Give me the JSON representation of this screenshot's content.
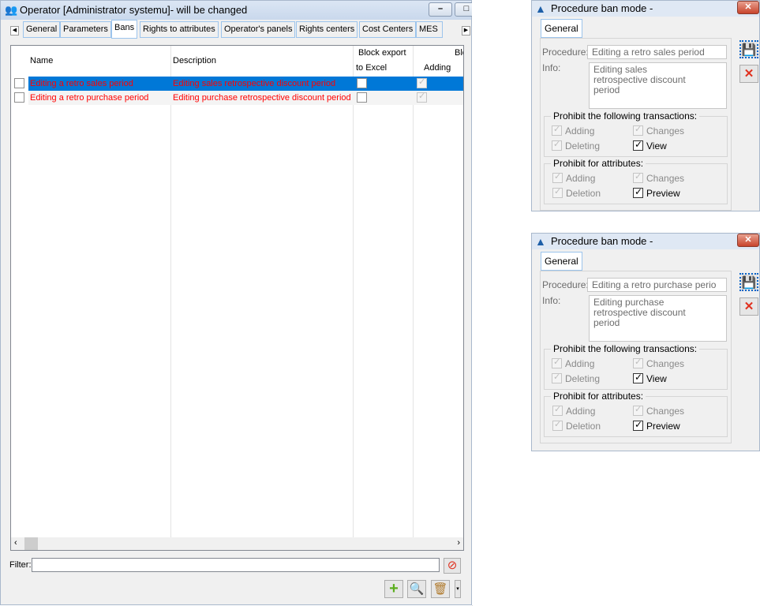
{
  "main": {
    "title": "Operator [Administrator systemu]- will be changed",
    "tabs": [
      "General",
      "Parameters",
      "Bans",
      "Rights to attributes",
      "Operator's panels",
      "Rights centers",
      "Cost Centers",
      "MES"
    ],
    "active_tab": "Bans",
    "columns": {
      "name": "Name",
      "description": "Description",
      "block_export_1": "Block export",
      "block_export_2": "to Excel",
      "block_2": "Blo",
      "adding": "Adding"
    },
    "rows": [
      {
        "name": "Editing a retro sales period",
        "description": "Editing sales retrospective discount period",
        "selected": true
      },
      {
        "name": "Editing a retro purchase period",
        "description": "Editing purchase retrospective discount period",
        "selected": false
      }
    ],
    "filter_label": "Filter:",
    "filter_value": "",
    "colors": {
      "selection": "#0078d7",
      "row_text": "#ff0000"
    }
  },
  "dialogs": [
    {
      "title": "Procedure ban mode -",
      "tab": "General",
      "procedure_label": "Procedure:",
      "procedure": "Editing a retro sales period",
      "info_label": "Info:",
      "info": "Editing sales retrospective discount period",
      "group1": "Prohibit the following transactions:",
      "g1": {
        "adding": "Adding",
        "changes": "Changes",
        "deleting": "Deleting",
        "view": "View"
      },
      "group2": "Prohibit for attributes:",
      "g2": {
        "adding": "Adding",
        "changes": "Changes",
        "deletion": "Deletion",
        "preview": "Preview"
      }
    },
    {
      "title": "Procedure ban mode -",
      "tab": "General",
      "procedure_label": "Procedure:",
      "procedure": "Editing a retro purchase perio",
      "info_label": "Info:",
      "info": "Editing purchase retrospective discount period",
      "group1": "Prohibit the following transactions:",
      "g1": {
        "adding": "Adding",
        "changes": "Changes",
        "deleting": "Deleting",
        "view": "View"
      },
      "group2": "Prohibit for attributes:",
      "g2": {
        "adding": "Adding",
        "changes": "Changes",
        "deletion": "Deletion",
        "preview": "Preview"
      }
    }
  ]
}
